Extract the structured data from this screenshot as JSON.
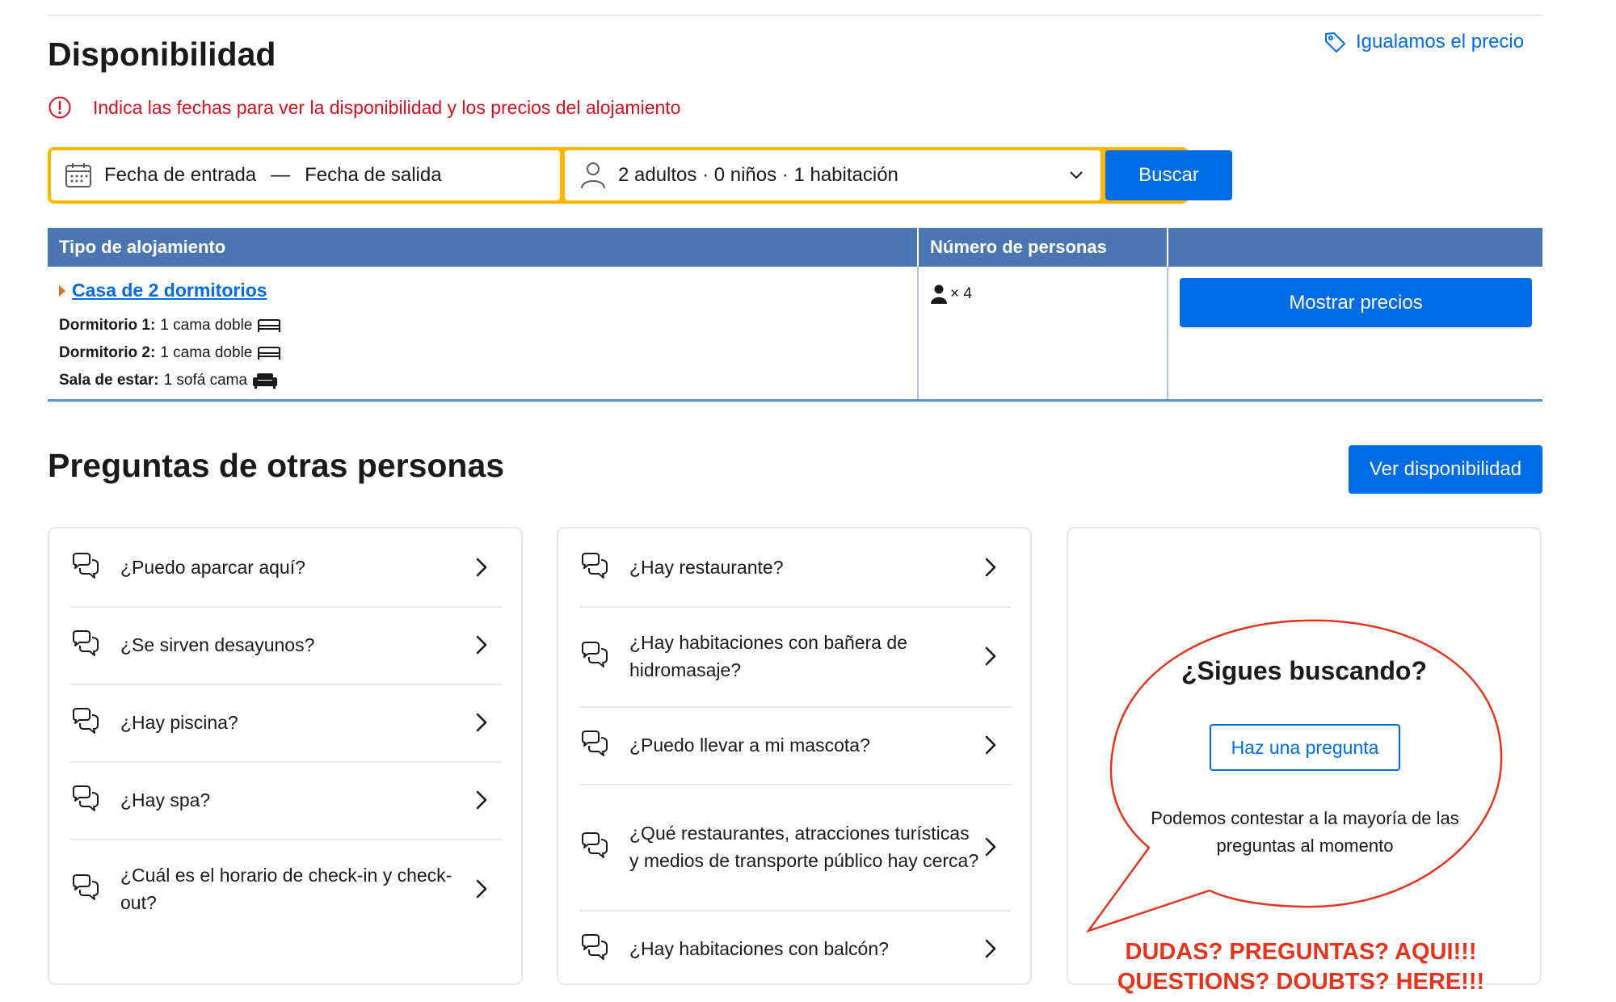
{
  "availability": {
    "title": "Disponibilidad",
    "price_match_label": "Igualamos el precio",
    "alert_text": "Indica las fechas para ver la disponibilidad y los precios del alojamiento"
  },
  "search": {
    "checkin": "Fecha de entrada",
    "dash": "—",
    "checkout": "Fecha de salida",
    "guests": "2 adultos · 0 niños · 1 habitación",
    "button": "Buscar",
    "accent_color": "#ffb700"
  },
  "table": {
    "headers": [
      "Tipo de alojamiento",
      "Número de personas",
      ""
    ],
    "room": {
      "name": "Casa de 2 dormitorios",
      "beds": [
        {
          "label": "Dormitorio 1:",
          "value": "1 cama doble",
          "icon": "bed-icon"
        },
        {
          "label": "Dormitorio 2:",
          "value": "1 cama doble",
          "icon": "bed-icon"
        },
        {
          "label": "Sala de estar:",
          "value": "1 sofá cama",
          "icon": "sofa-icon"
        }
      ],
      "persons": "× 4",
      "button": "Mostrar precios"
    }
  },
  "questions": {
    "title": "Preguntas de otras personas",
    "availability_button": "Ver disponibilidad",
    "col1": [
      "¿Puedo aparcar aquí?",
      "¿Se sirven desayunos?",
      "¿Hay piscina?",
      "¿Hay spa?",
      "¿Cuál es el horario de check-in y check-out?"
    ],
    "col2": [
      "¿Hay restaurante?",
      "¿Hay habitaciones con bañera de hidromasaje?",
      "¿Puedo llevar a mi mascota?",
      "¿Qué restaurantes, atracciones turísticas y medios de transporte público hay cerca?",
      "¿Hay habitaciones con balcón?"
    ],
    "help": {
      "title": "¿Sigues buscando?",
      "button": "Haz una pregunta",
      "text": "Podemos contestar a la mayoría de las preguntas al momento"
    }
  },
  "annotation": {
    "line1": "DUDAS? PREGUNTAS? AQUI!!!",
    "line2": "QUESTIONS? DOUBTS? HERE!!!",
    "color": "#e3351e"
  },
  "colors": {
    "primary": "#006ce4",
    "table_header": "#4c76b2",
    "alert": "#d4111e"
  }
}
